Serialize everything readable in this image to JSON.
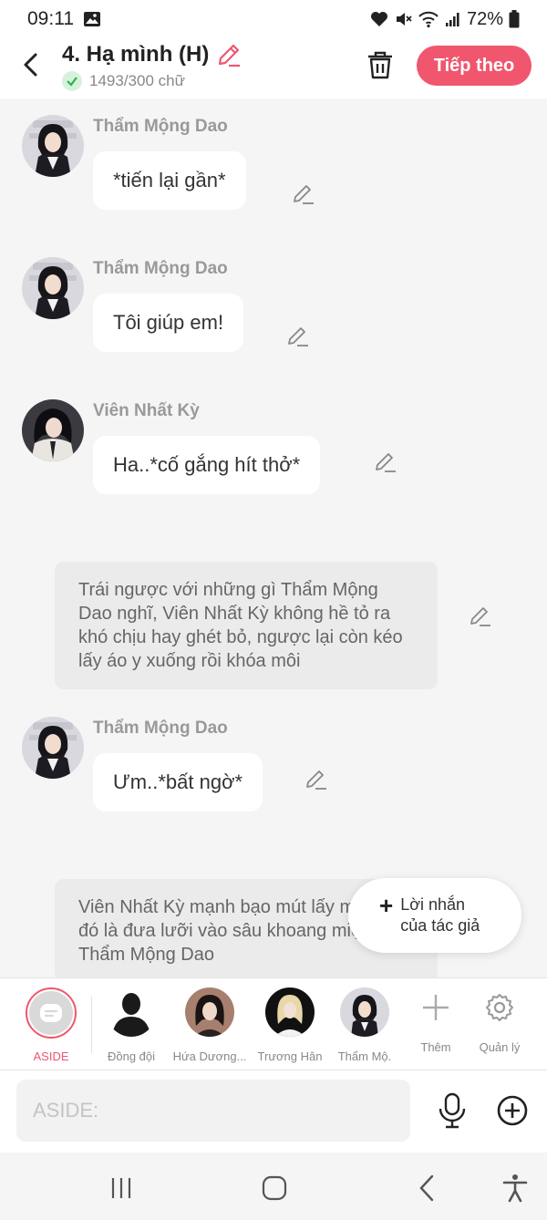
{
  "status_bar": {
    "time": "09:11",
    "battery": "72%"
  },
  "header": {
    "title": "4. Hạ mình (H)",
    "word_count": "1493/300 chữ",
    "next_label": "Tiếp theo"
  },
  "messages": [
    {
      "type": "char",
      "name": "Thẩm Mộng Dao",
      "text": "*tiến lại gần*"
    },
    {
      "type": "char",
      "name": "Thẩm Mộng Dao",
      "text": "Tôi giúp em!"
    },
    {
      "type": "char",
      "name": "Viên Nhất Kỳ",
      "text": "Ha..*cố gắng hít thở*"
    },
    {
      "type": "narration",
      "text": "Trái ngược với những gì Thẩm Mộng Dao nghĩ, Viên Nhất Kỳ không hề tỏ ra khó chịu hay ghét bỏ, ngược lại còn kéo lấy áo y xuống rồi khóa môi"
    },
    {
      "type": "char",
      "name": "Thẩm Mộng Dao",
      "text": "Ưm..*bất ngờ*"
    },
    {
      "type": "narration",
      "text": "Viên Nhất Kỳ mạnh bạo mút lấy môi, sau đó là đưa lưỡi vào sâu khoang miệng Thẩm Mộng Dao"
    }
  ],
  "author_note": {
    "line1": "Lời nhắn",
    "line2": "của tác giả"
  },
  "character_bar": {
    "aside": "ASIDE",
    "items": [
      "Đồng đội",
      "Hứa Dương...",
      "Trương Hân",
      "Thẩm Mộ."
    ],
    "add_label": "Thêm",
    "manage_label": "Quản lý"
  },
  "input": {
    "placeholder": "ASIDE:"
  },
  "colors": {
    "accent": "#f0566e",
    "background": "#f5f5f5",
    "bubble": "#ffffff",
    "narration": "#ebebeb"
  }
}
